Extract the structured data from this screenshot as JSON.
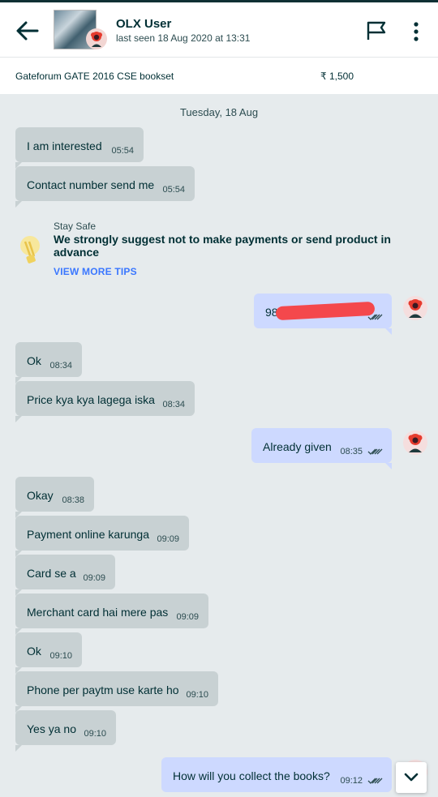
{
  "header": {
    "user_name": "OLX User",
    "last_seen": "last seen 18 Aug 2020 at 13:31",
    "back_icon": "arrow-left-icon",
    "flag_icon": "flag-icon",
    "menu_icon": "more-vertical-icon"
  },
  "ad": {
    "title": "Gateforum GATE 2016 CSE bookset",
    "price": "₹ 1,500"
  },
  "chat": {
    "day_label": "Tuesday, 18 Aug",
    "messages": [
      {
        "text": "I am interested",
        "time": "05:54",
        "dir": "in"
      },
      {
        "text": "Contact number send me",
        "time": "05:54",
        "dir": "in"
      },
      {
        "text": "98",
        "time": "",
        "dir": "out",
        "redacted": true
      },
      {
        "text": "Ok",
        "time": "08:34",
        "dir": "in"
      },
      {
        "text": "Price kya kya lagega iska",
        "time": "08:34",
        "dir": "in"
      },
      {
        "text": "Already given",
        "time": "08:35",
        "dir": "out"
      },
      {
        "text": "Okay",
        "time": "08:38",
        "dir": "in"
      },
      {
        "text": "Payment online karunga",
        "time": "09:09",
        "dir": "in"
      },
      {
        "text": "Card se a",
        "time": "09:09",
        "dir": "in"
      },
      {
        "text": "Merchant card hai mere pas",
        "time": "09:09",
        "dir": "in"
      },
      {
        "text": "Ok",
        "time": "09:10",
        "dir": "in"
      },
      {
        "text": "Phone per paytm use karte ho",
        "time": "09:10",
        "dir": "in"
      },
      {
        "text": "Yes ya no",
        "time": "09:10",
        "dir": "in"
      },
      {
        "text": "How will you collect the books?",
        "time": "09:12",
        "dir": "out"
      }
    ]
  },
  "safety_tip": {
    "heading": "Stay Safe",
    "body": "We strongly suggest not to make payments or send product in advance",
    "link": "VIEW MORE TIPS",
    "icon": "lightbulb-icon"
  },
  "colors": {
    "incoming_bubble": "#c8d1d3",
    "outgoing_bubble": "#cdd9ff",
    "background": "#e6ebed",
    "link": "#3a77ff",
    "text": "#002f34"
  }
}
